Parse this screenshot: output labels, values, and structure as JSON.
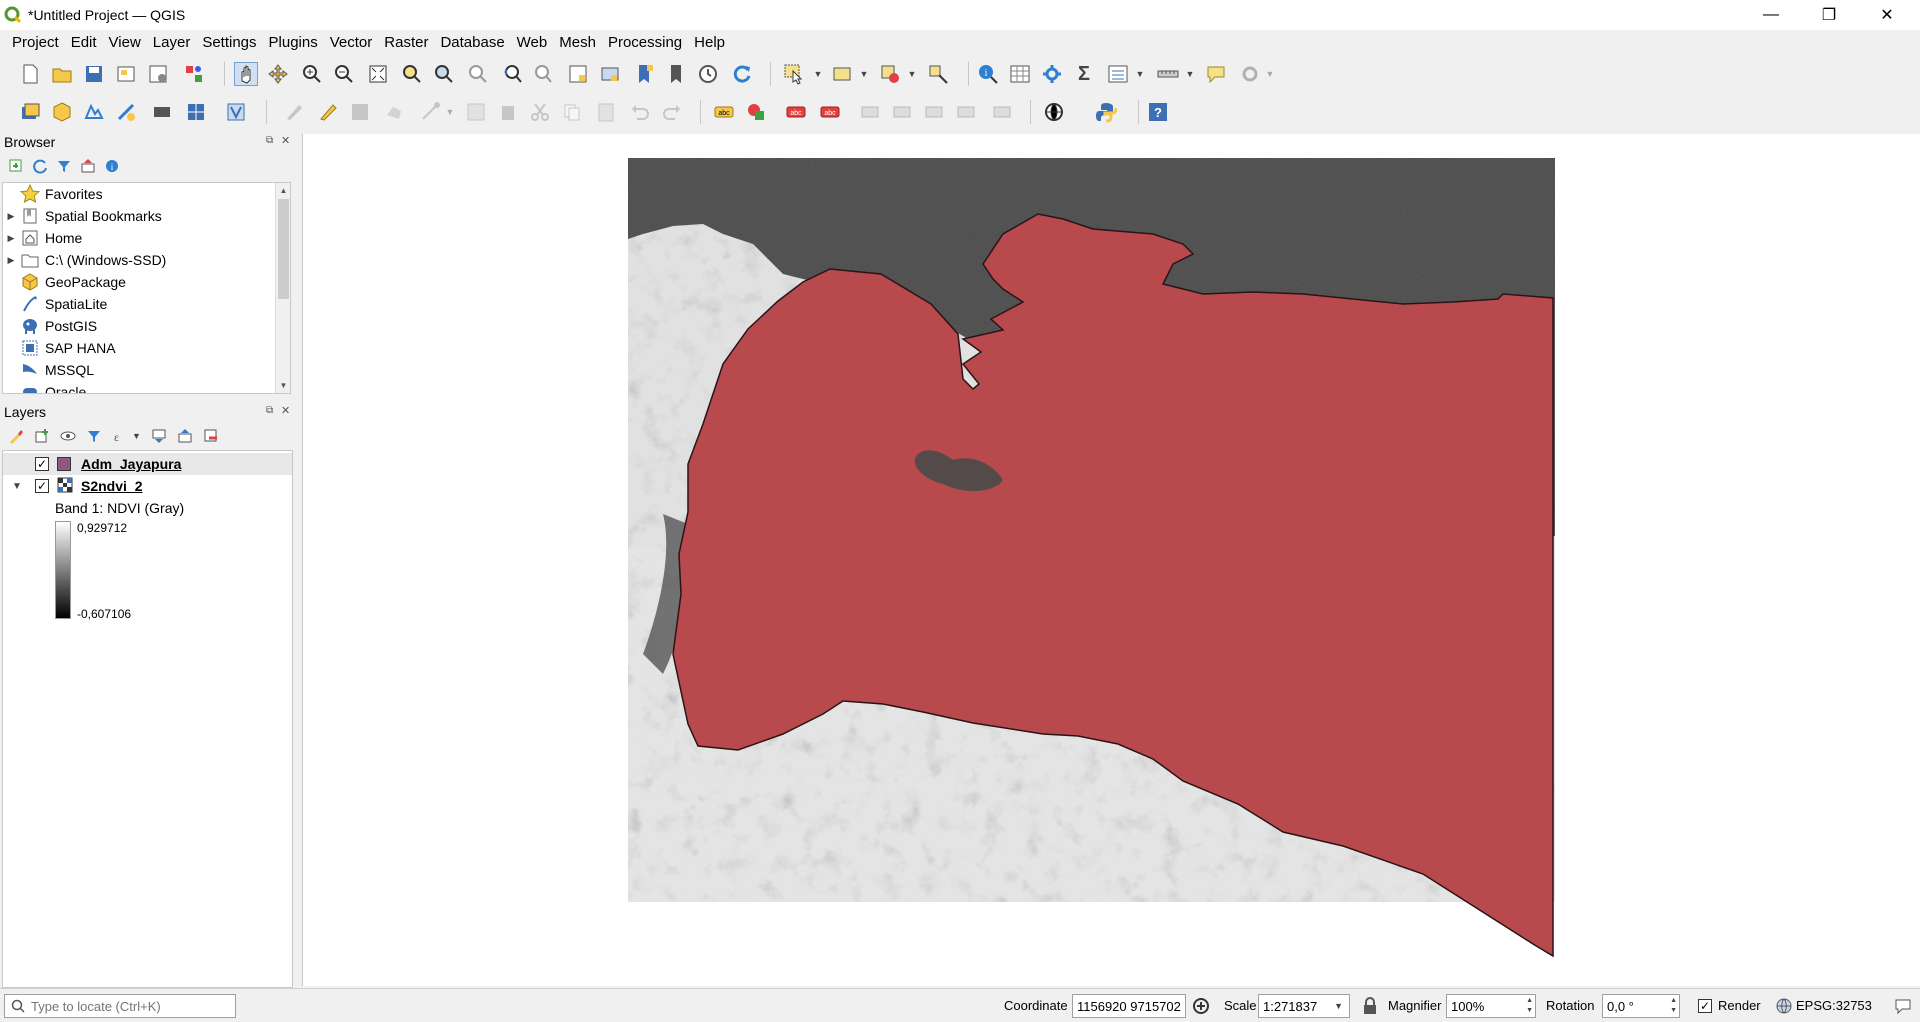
{
  "window": {
    "title": "*Untitled Project — QGIS",
    "minimize": "—",
    "restore": "❐",
    "close": "✕"
  },
  "menu": [
    "Project",
    "Edit",
    "View",
    "Layer",
    "Settings",
    "Plugins",
    "Vector",
    "Raster",
    "Database",
    "Web",
    "Mesh",
    "Processing",
    "Help"
  ],
  "browser": {
    "title": "Browser",
    "items": [
      {
        "label": "Favorites",
        "icon": "star-icon",
        "expandable": false
      },
      {
        "label": "Spatial Bookmarks",
        "icon": "bookmark-icon",
        "expandable": true
      },
      {
        "label": "Home",
        "icon": "home-icon",
        "expandable": true
      },
      {
        "label": "C:\\ (Windows-SSD)",
        "icon": "folder-icon",
        "expandable": true
      },
      {
        "label": "GeoPackage",
        "icon": "geopackage-icon",
        "expandable": false
      },
      {
        "label": "SpatiaLite",
        "icon": "spatialite-icon",
        "expandable": false
      },
      {
        "label": "PostGIS",
        "icon": "postgis-icon",
        "expandable": false
      },
      {
        "label": "SAP HANA",
        "icon": "sap-hana-icon",
        "expandable": false
      },
      {
        "label": "MSSQL",
        "icon": "mssql-icon",
        "expandable": false
      },
      {
        "label": "Oracle",
        "icon": "oracle-icon",
        "expandable": false
      }
    ]
  },
  "layers": {
    "title": "Layers",
    "items": [
      {
        "name": "Adm_Jayapura",
        "checked": true,
        "swatch": "#8b5a7e"
      },
      {
        "name": "S2ndvi_2",
        "checked": true
      }
    ],
    "band": "Band 1: NDVI (Gray)",
    "max": "0,929712",
    "min": "-0,607106"
  },
  "colors": {
    "polygon_fill": "#b84a4e",
    "polygon_stroke": "#2a1416",
    "sea": "#4a4a4a",
    "land": "#e4e4e4"
  },
  "status": {
    "locator_placeholder": "Type to locate (Ctrl+K)",
    "coordinate_label": "Coordinate",
    "coordinate": "1156920 9715702",
    "scale_label": "Scale",
    "scale": "1:271837",
    "magnifier_label": "Magnifier",
    "magnifier": "100%",
    "rotation_label": "Rotation",
    "rotation": "0,0 °",
    "render_label": "Render",
    "crs": "EPSG:32753"
  }
}
